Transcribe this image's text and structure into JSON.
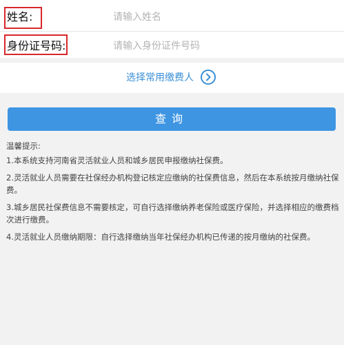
{
  "form": {
    "name_label": "姓名:",
    "name_placeholder": "请输入姓名",
    "id_label": "身份证号码:",
    "id_placeholder": "请输入身份证件号码"
  },
  "payer": {
    "link_text": "选择常用缴费人",
    "icon": "chevron-right-circle-icon"
  },
  "query_button": "查询",
  "tips": {
    "title": "温馨提示:",
    "items": [
      "1.本系统支持河南省灵活就业人员和城乡居民申报缴纳社保费。",
      "2.灵活就业人员需要在社保经办机构登记核定应缴纳的社保费信息，然后在本系统按月缴纳社保费。",
      "3.城乡居民社保费信息不需要核定，可自行选择缴纳养老保险或医疗保险，并选择相应的缴费档次进行缴费。",
      "4.灵活就业人员缴纳期限：自行选择缴纳当年社保经办机构已传递的按月缴纳的社保费。"
    ]
  },
  "colors": {
    "accent": "#3e95e2",
    "link": "#3a8fd6",
    "highlight": "#d8262a",
    "background": "#f2f2f2"
  }
}
